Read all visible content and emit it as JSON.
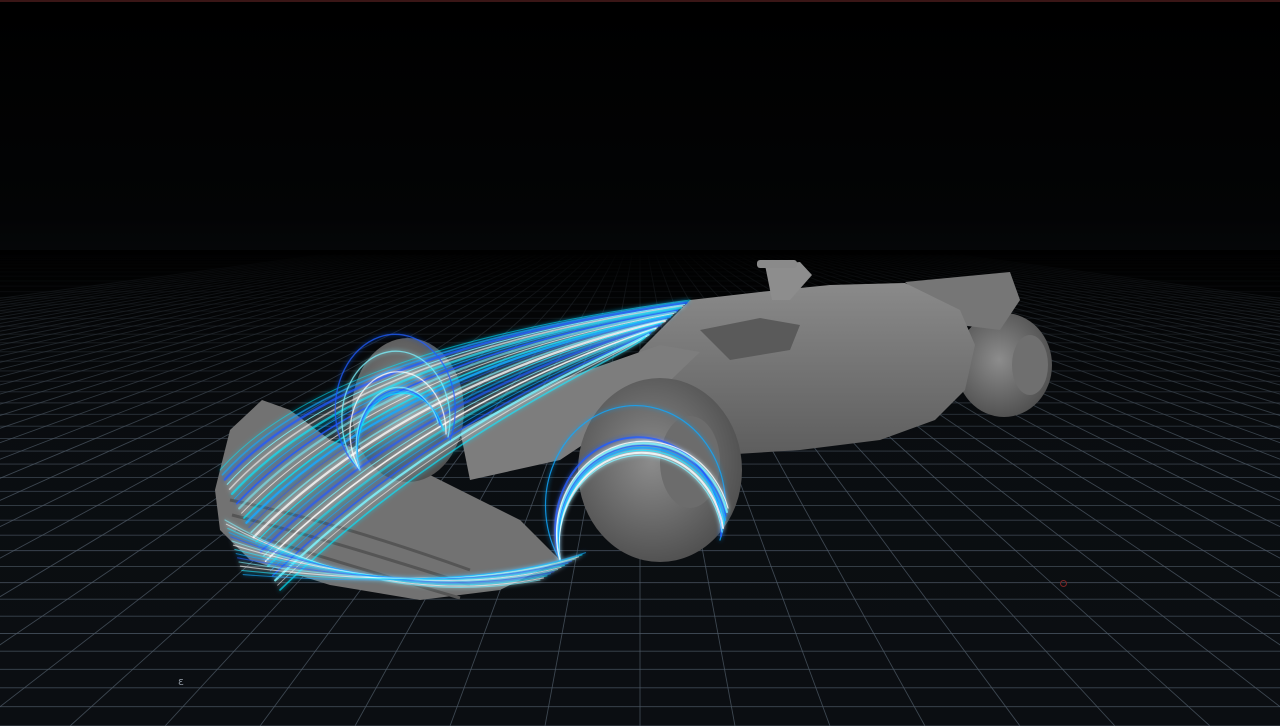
{
  "viewport": {
    "background_top": "#000000",
    "floor_color": "#0b0e12",
    "grid_line_color": "#4d5966",
    "border_color": "#3a1616"
  },
  "scene": {
    "subject": "f1-car-model",
    "body_color": "#7b7b7b",
    "body_shadow_color": "#4a4a4a",
    "tyre_color": "#5e5e5e",
    "streamline_colors": [
      "#00e6ff",
      "#14a8ff",
      "#1e5cff",
      "#7ef3ff",
      "#ffffff"
    ]
  },
  "overlays": {
    "axis_gizmo_glyph": "ε",
    "origin_marker_color": "#7a2424"
  }
}
